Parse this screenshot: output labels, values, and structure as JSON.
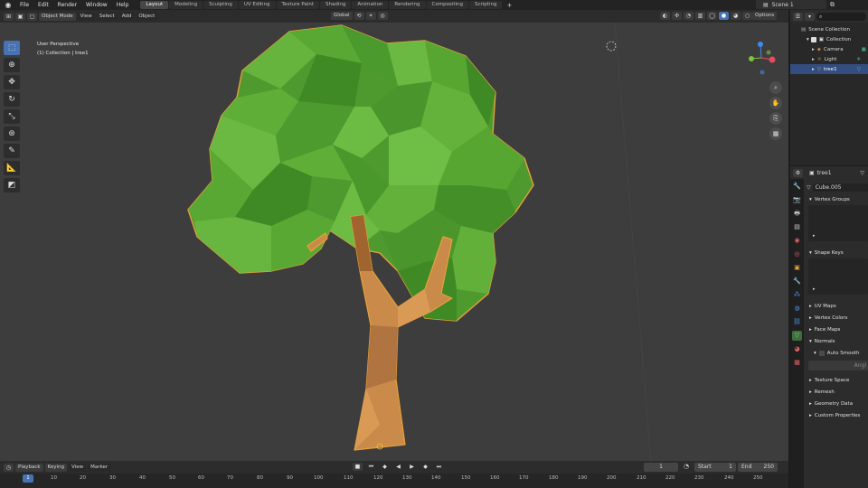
{
  "topbar": {
    "menus": [
      "File",
      "Edit",
      "Render",
      "Window",
      "Help"
    ],
    "workspaces": [
      "Layout",
      "Modeling",
      "Sculpting",
      "UV Editing",
      "Texture Paint",
      "Shading",
      "Animation",
      "Rendering",
      "Compositing",
      "Scripting"
    ],
    "active_workspace": "Layout",
    "add_tab": "+",
    "scene": "Scene 1"
  },
  "viewport_header": {
    "mode": "Object Mode",
    "menus": [
      "View",
      "Select",
      "Add",
      "Object"
    ],
    "orientation": "Global",
    "options": "Options"
  },
  "viewport": {
    "perspective": "User Perspective",
    "collection_info": "(1) Collection | tree1"
  },
  "timeline": {
    "menus": [
      "Playback",
      "Keying",
      "View",
      "Marker"
    ],
    "current_frame": "1",
    "start_label": "Start",
    "start": "1",
    "end_label": "End",
    "end": "250",
    "ruler": [
      "1",
      "10",
      "20",
      "30",
      "40",
      "50",
      "60",
      "70",
      "80",
      "90",
      "100",
      "110",
      "120",
      "130",
      "140",
      "150",
      "160",
      "170",
      "180",
      "190",
      "200",
      "210",
      "220",
      "230",
      "240",
      "250"
    ]
  },
  "outliner": {
    "rows": [
      {
        "label": "Scene Collection"
      },
      {
        "label": "Collection"
      },
      {
        "label": "Camera"
      },
      {
        "label": "Light"
      },
      {
        "label": "tree1"
      }
    ]
  },
  "properties": {
    "object": "tree1",
    "mesh": "Cube.005",
    "panels": {
      "vertex_groups": "Vertex Groups",
      "shape_keys": "Shape Keys",
      "uv_maps": "UV Maps",
      "vertex_colors": "Vertex Colors",
      "face_maps": "Face Maps",
      "normals": "Normals",
      "auto_smooth": "Auto Smooth",
      "angle": "Angl",
      "texture_space": "Texture Space",
      "remesh": "Remesh",
      "geometry_data": "Geometry Data",
      "custom_properties": "Custom Properties"
    }
  },
  "colors": {
    "accent": "#4772b3",
    "selection_outline": "#e8a03a",
    "foliage": "#5aa033",
    "trunk": "#c98a4a",
    "x_axis": "#e84a5f",
    "y_axis": "#7cc43a",
    "z_axis": "#3e8bea"
  }
}
